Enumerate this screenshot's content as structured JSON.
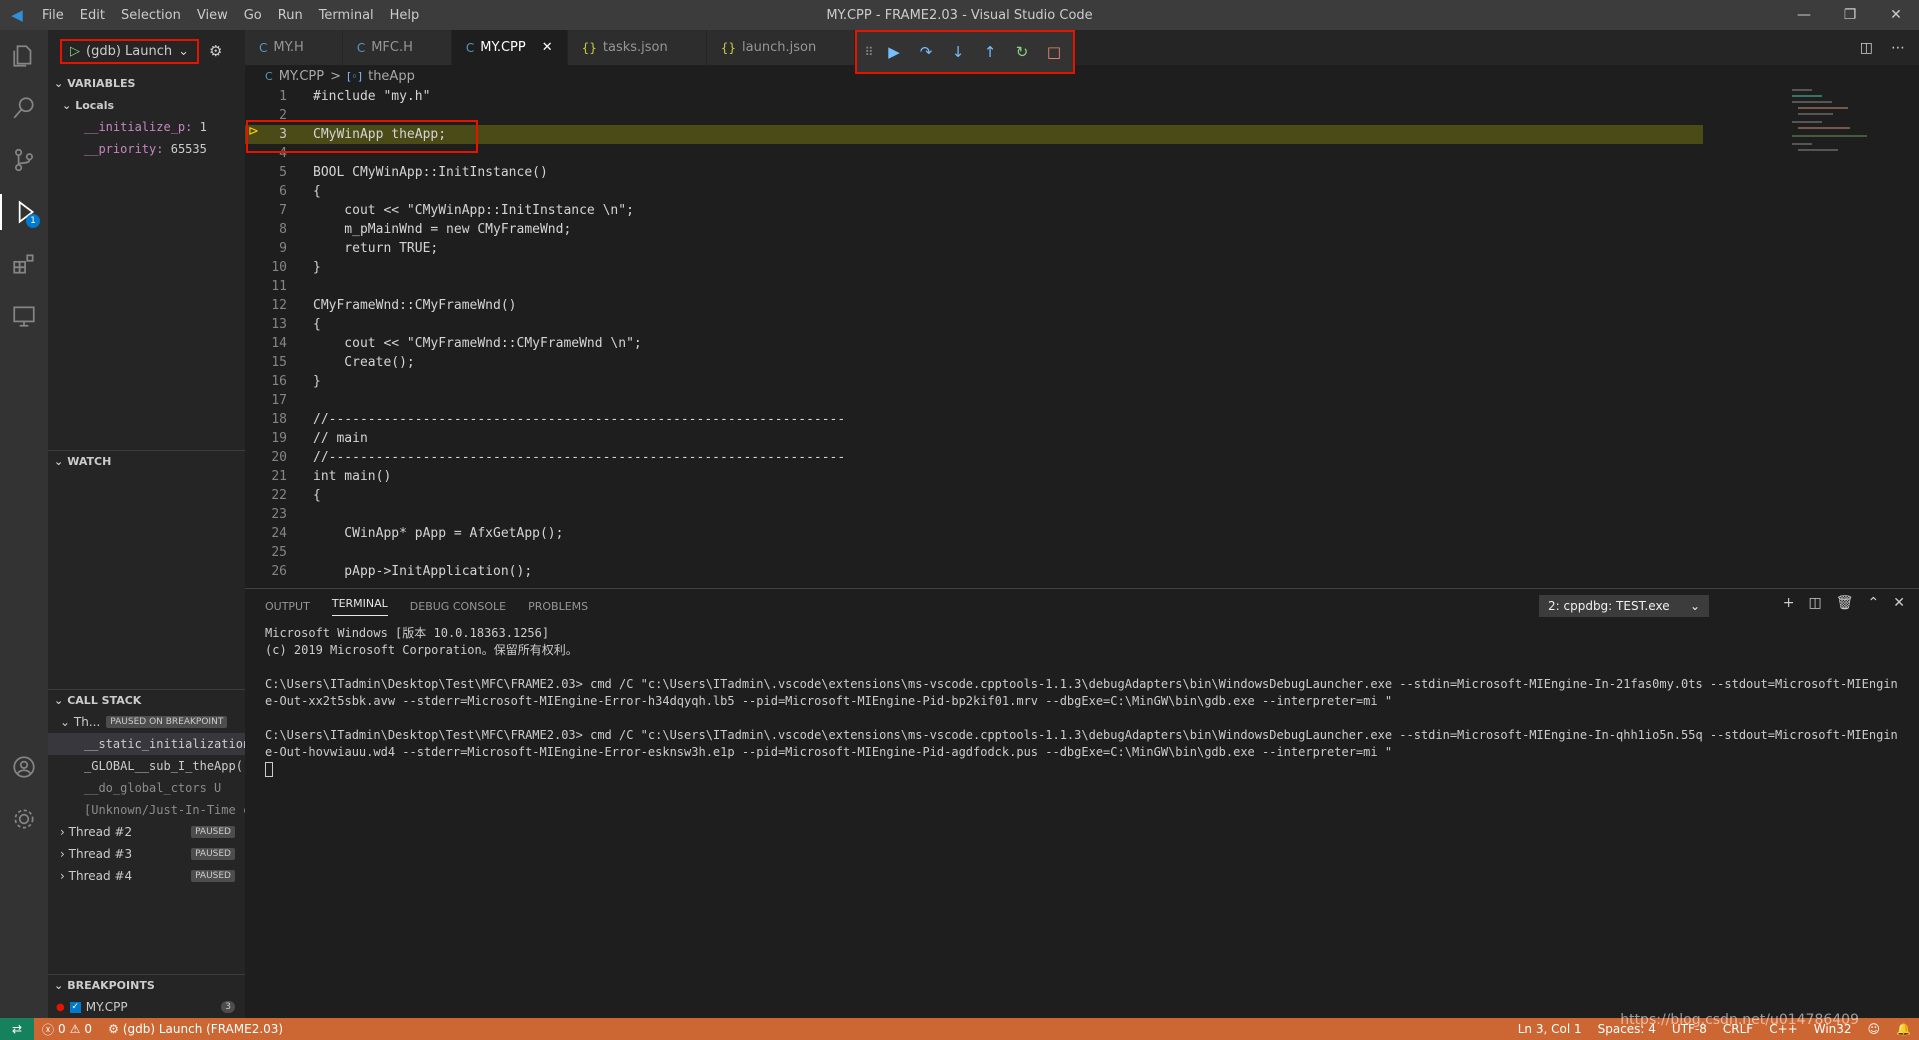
{
  "window": {
    "title": "MY.CPP - FRAME2.03 - Visual Studio Code",
    "menu": [
      "File",
      "Edit",
      "Selection",
      "View",
      "Go",
      "Run",
      "Terminal",
      "Help"
    ]
  },
  "activity": {
    "debug_badge": "1"
  },
  "sidebar": {
    "launch_config": "(gdb) Launch",
    "variables": {
      "title": "VARIABLES",
      "locals_label": "Locals",
      "items": [
        {
          "name": "__initialize_p:",
          "value": "1"
        },
        {
          "name": "__priority:",
          "value": "65535"
        }
      ]
    },
    "watch": {
      "title": "WATCH"
    },
    "call_stack": {
      "title": "CALL STACK",
      "thread1": "Th...",
      "thread1_status": "PAUSED ON BREAKPOINT",
      "frames": [
        "__static_initialization",
        "_GLOBAL__sub_I_theApp(",
        "__do_global_ctors  U",
        "[Unknown/Just-In-Time c"
      ],
      "threads": [
        {
          "name": "Thread #2",
          "status": "PAUSED"
        },
        {
          "name": "Thread #3",
          "status": "PAUSED"
        },
        {
          "name": "Thread #4",
          "status": "PAUSED"
        }
      ]
    },
    "breakpoints": {
      "title": "BREAKPOINTS",
      "file": "MY.CPP",
      "count": "3"
    }
  },
  "tabs": [
    {
      "label": "MY.H",
      "icon": "C"
    },
    {
      "label": "MFC.H",
      "icon": "C"
    },
    {
      "label": "MY.CPP",
      "icon": "C"
    },
    {
      "label": "tasks.json",
      "icon": "{}"
    },
    {
      "label": "launch.json",
      "icon": "{}"
    }
  ],
  "breadcrumb": {
    "file": "MY.CPP",
    "sep": ">",
    "symbol": "theApp"
  },
  "editor": {
    "line_numbers": [
      "1",
      "2",
      "3",
      "4",
      "5",
      "6",
      "7",
      "8",
      "9",
      "10",
      "11",
      "12",
      "13",
      "14",
      "15",
      "16",
      "17",
      "18",
      "19",
      "20",
      "21",
      "22",
      "23",
      "24",
      "25",
      "26"
    ],
    "lines": [
      "#include \"my.h\"",
      "",
      "CMyWinApp theApp;",
      "",
      "BOOL CMyWinApp::InitInstance()",
      "{",
      "    cout << \"CMyWinApp::InitInstance \\n\";",
      "    m_pMainWnd = new CMyFrameWnd;",
      "    return TRUE;",
      "}",
      "",
      "CMyFrameWnd::CMyFrameWnd()",
      "{",
      "    cout << \"CMyFrameWnd::CMyFrameWnd \\n\";",
      "    Create();",
      "}",
      "",
      "//------------------------------------------------------------------",
      "// main",
      "//------------------------------------------------------------------",
      "int main()",
      "{",
      "",
      "    CWinApp* pApp = AfxGetApp();",
      "",
      "    pApp->InitApplication();"
    ]
  },
  "panel": {
    "tabs": [
      "OUTPUT",
      "TERMINAL",
      "DEBUG CONSOLE",
      "PROBLEMS"
    ],
    "terminal_selector": "2: cppdbg: TEST.exe",
    "terminal_lines": [
      "Microsoft Windows [版本 10.0.18363.1256]",
      "(c) 2019 Microsoft Corporation。保留所有权利。",
      "",
      "C:\\Users\\ITadmin\\Desktop\\Test\\MFC\\FRAME2.03> cmd /C \"c:\\Users\\ITadmin\\.vscode\\extensions\\ms-vscode.cpptools-1.1.3\\debugAdapters\\bin\\WindowsDebugLauncher.exe --stdin=Microsoft-MIEngine-In-21fas0my.0ts --stdout=Microsoft-MIEngine-Out-xx2t5sbk.avw --stderr=Microsoft-MIEngine-Error-h34dqyqh.lb5 --pid=Microsoft-MIEngine-Pid-bp2kif01.mrv --dbgExe=C:\\MinGW\\bin\\gdb.exe --interpreter=mi \"",
      "",
      "C:\\Users\\ITadmin\\Desktop\\Test\\MFC\\FRAME2.03> cmd /C \"c:\\Users\\ITadmin\\.vscode\\extensions\\ms-vscode.cpptools-1.1.3\\debugAdapters\\bin\\WindowsDebugLauncher.exe --stdin=Microsoft-MIEngine-In-qhh1io5n.55q --stdout=Microsoft-MIEngine-Out-hovwiauu.wd4 --stderr=Microsoft-MIEngine-Error-esknsw3h.e1p --pid=Microsoft-MIEngine-Pid-agdfodck.pus --dbgExe=C:\\MinGW\\bin\\gdb.exe --interpreter=mi \""
    ]
  },
  "status": {
    "errors": "0",
    "warnings": "0",
    "debug": "(gdb) Launch (FRAME2.03)",
    "position": "Ln 3, Col 1",
    "spaces": "Spaces: 4",
    "encoding": "UTF-8",
    "eol": "CRLF",
    "language": "C++",
    "platform": "Win32"
  },
  "watermark": "https://blog.csdn.net/u014786409",
  "colors": {
    "accent": "#007acc",
    "statusbar": "#cc6633",
    "highlight_box": "#e51400"
  }
}
